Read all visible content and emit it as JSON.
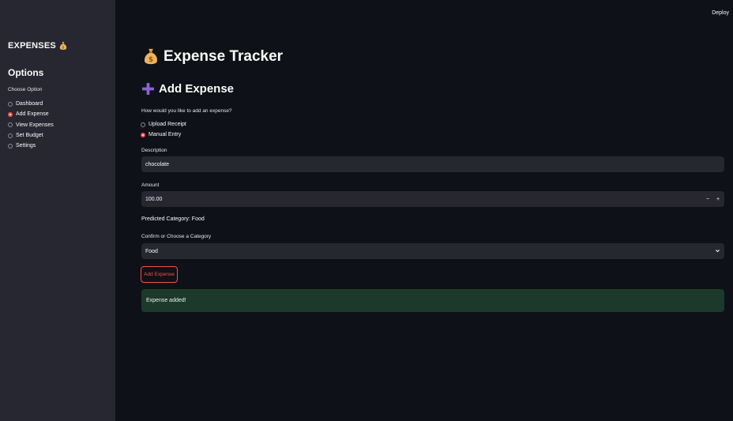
{
  "toolbar": {
    "deploy_label": "Deploy"
  },
  "sidebar": {
    "title": "EXPENSES",
    "options_heading": "Options",
    "choose_label": "Choose Option",
    "items": [
      {
        "label": "Dashboard",
        "selected": false
      },
      {
        "label": "Add Expense",
        "selected": true
      },
      {
        "label": "View Expenses",
        "selected": false
      },
      {
        "label": "Set Budget",
        "selected": false
      },
      {
        "label": "Settings",
        "selected": false
      }
    ]
  },
  "main": {
    "title": "Expense Tracker",
    "section_title": "Add Expense",
    "question": "How would you like to add an expense?",
    "methods": [
      {
        "label": "Upload Receipt",
        "selected": false
      },
      {
        "label": "Manual Entry",
        "selected": true
      }
    ],
    "description": {
      "label": "Description",
      "value": "chocolate"
    },
    "amount": {
      "label": "Amount",
      "value": "100.00",
      "minus": "−",
      "plus": "+"
    },
    "predicted": "Predicted Category: Food",
    "category": {
      "label": "Confirm or Choose a Category",
      "value": "Food"
    },
    "add_button": "Add Expense",
    "success_message": "Expense added!"
  },
  "colors": {
    "background": "#0e1117",
    "sidebar": "#262730",
    "accent": "#ff4b4b",
    "success_bg": "#1b3a2b",
    "plus_icon": "#8a63d2"
  },
  "icons": {
    "sidebar_title": "money-bag-icon",
    "page_title": "money-bag-icon",
    "section_title": "plus-icon",
    "select": "chevron-down-icon"
  }
}
